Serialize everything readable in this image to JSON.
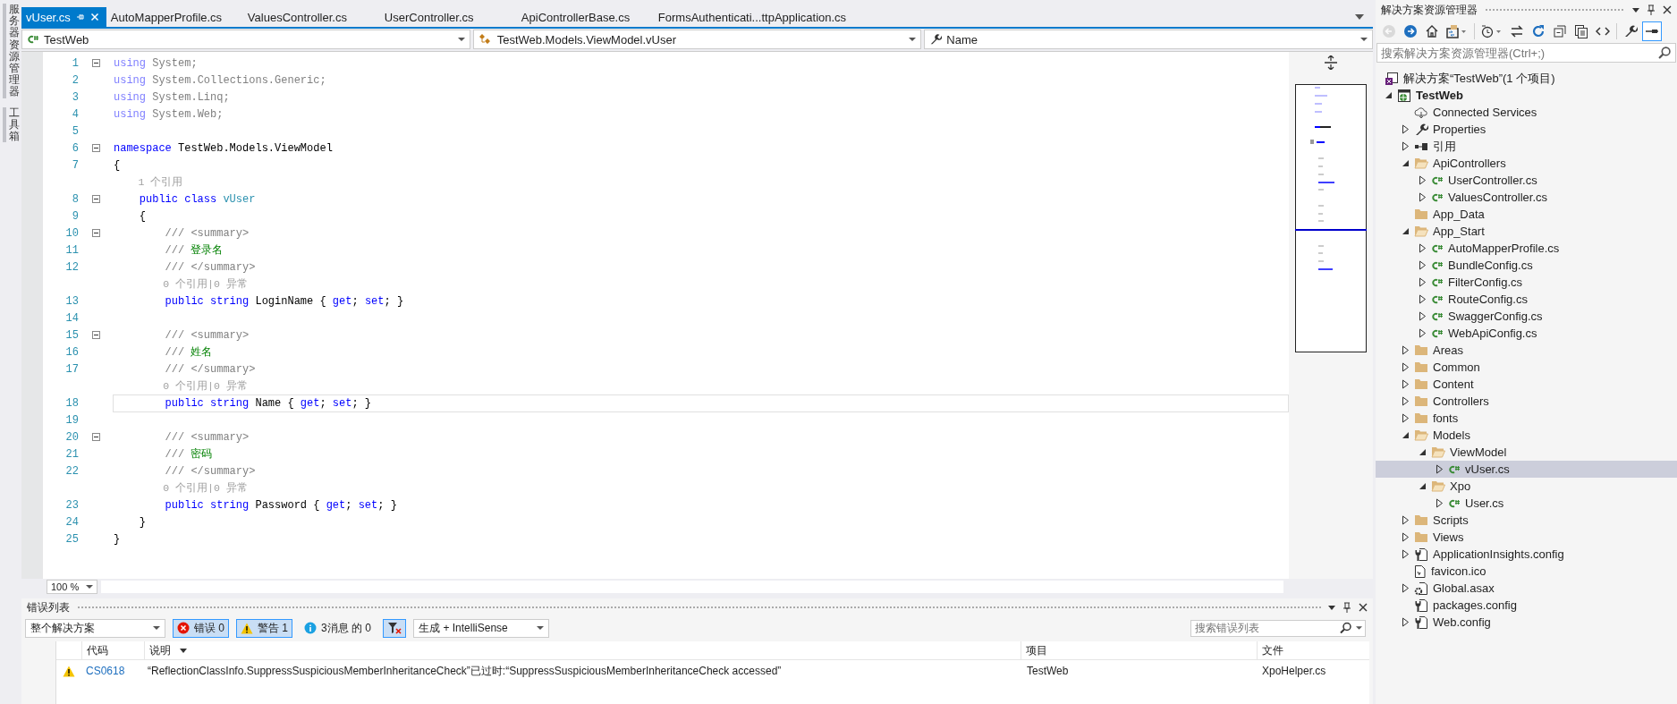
{
  "side_strip": {
    "tabs": [
      {
        "label": "服务器资源管理器"
      },
      {
        "label": "工具箱"
      }
    ]
  },
  "editor": {
    "tabs": [
      {
        "label": "vUser.cs",
        "selected": true
      },
      {
        "label": "AutoMapperProfile.cs",
        "selected": false
      },
      {
        "label": "ValuesController.cs",
        "selected": false
      },
      {
        "label": "UserController.cs",
        "selected": false
      },
      {
        "label": "ApiControllerBase.cs",
        "selected": false
      },
      {
        "label": "FormsAuthenticati...ttpApplication.cs",
        "selected": false
      }
    ],
    "nav": {
      "project": "TestWeb",
      "type": "TestWeb.Models.ViewModel.vUser",
      "member": "Name"
    },
    "lines": [
      {
        "kind": "code",
        "number": "1",
        "foldable": true,
        "current": false,
        "segments": [
          {
            "kind": "faded-keyword",
            "text": "using"
          },
          {
            "kind": "faded",
            "text": " System;"
          }
        ]
      },
      {
        "kind": "code",
        "number": "2",
        "foldable": false,
        "current": false,
        "segments": [
          {
            "kind": "faded-keyword",
            "text": "using"
          },
          {
            "kind": "faded",
            "text": " System.Collections.Generic;"
          }
        ]
      },
      {
        "kind": "code",
        "number": "3",
        "foldable": false,
        "current": false,
        "segments": [
          {
            "kind": "faded-keyword",
            "text": "using"
          },
          {
            "kind": "faded",
            "text": " System.Linq;"
          }
        ]
      },
      {
        "kind": "code",
        "number": "4",
        "foldable": false,
        "current": false,
        "segments": [
          {
            "kind": "faded-keyword",
            "text": "using"
          },
          {
            "kind": "faded",
            "text": " System.Web;"
          }
        ]
      },
      {
        "kind": "code",
        "number": "5",
        "foldable": false,
        "current": false
      },
      {
        "kind": "code",
        "number": "6",
        "foldable": true,
        "current": false,
        "segments": [
          {
            "kind": "keyword",
            "text": "namespace"
          },
          {
            "kind": "plain",
            "text": " TestWeb.Models.ViewModel"
          }
        ]
      },
      {
        "kind": "code",
        "number": "7",
        "foldable": false,
        "current": false,
        "segments": [
          {
            "kind": "plain",
            "text": "{"
          }
        ]
      },
      {
        "kind": "codelens",
        "text": "    1 个引用"
      },
      {
        "kind": "code",
        "number": "8",
        "foldable": true,
        "current": false,
        "segments": [
          {
            "kind": "keyword",
            "text": "    public class "
          },
          {
            "kind": "type",
            "text": "vUser"
          }
        ]
      },
      {
        "kind": "code",
        "number": "9",
        "foldable": false,
        "current": false,
        "segments": [
          {
            "kind": "plain",
            "text": "    {"
          }
        ]
      },
      {
        "kind": "code",
        "number": "10",
        "foldable": true,
        "current": false,
        "segments": [
          {
            "kind": "doc",
            "text": "        /// <summary>"
          }
        ]
      },
      {
        "kind": "code",
        "number": "11",
        "foldable": false,
        "current": false,
        "segments": [
          {
            "kind": "doc",
            "text": "        /// "
          },
          {
            "kind": "comment",
            "text": "登录名"
          }
        ]
      },
      {
        "kind": "code",
        "number": "12",
        "foldable": false,
        "current": false,
        "segments": [
          {
            "kind": "doc",
            "text": "        /// </summary>"
          }
        ]
      },
      {
        "kind": "codelens",
        "text": "        0 个引用|0 异常"
      },
      {
        "kind": "code",
        "number": "13",
        "foldable": false,
        "current": false,
        "segments": [
          {
            "kind": "keyword",
            "text": "        public string"
          },
          {
            "kind": "plain",
            "text": " LoginName { "
          },
          {
            "kind": "keyword",
            "text": "get"
          },
          {
            "kind": "plain",
            "text": "; "
          },
          {
            "kind": "keyword",
            "text": "set"
          },
          {
            "kind": "plain",
            "text": "; }"
          }
        ]
      },
      {
        "kind": "code",
        "number": "14",
        "foldable": false,
        "current": false
      },
      {
        "kind": "code",
        "number": "15",
        "foldable": true,
        "current": false,
        "segments": [
          {
            "kind": "doc",
            "text": "        /// <summary>"
          }
        ]
      },
      {
        "kind": "code",
        "number": "16",
        "foldable": false,
        "current": false,
        "segments": [
          {
            "kind": "doc",
            "text": "        /// "
          },
          {
            "kind": "comment",
            "text": "姓名"
          }
        ]
      },
      {
        "kind": "code",
        "number": "17",
        "foldable": false,
        "current": false,
        "segments": [
          {
            "kind": "doc",
            "text": "        /// </summary>"
          }
        ]
      },
      {
        "kind": "codelens",
        "text": "        0 个引用|0 异常"
      },
      {
        "kind": "code",
        "number": "18",
        "foldable": false,
        "current": true,
        "segments": [
          {
            "kind": "keyword",
            "text": "        public string"
          },
          {
            "kind": "plain",
            "text": " Name { "
          },
          {
            "kind": "keyword",
            "text": "get"
          },
          {
            "kind": "plain",
            "text": "; "
          },
          {
            "kind": "keyword",
            "text": "set"
          },
          {
            "kind": "plain",
            "text": "; }"
          }
        ]
      },
      {
        "kind": "code",
        "number": "19",
        "foldable": false,
        "current": false
      },
      {
        "kind": "code",
        "number": "20",
        "foldable": true,
        "current": false,
        "segments": [
          {
            "kind": "doc",
            "text": "        /// <summary>"
          }
        ]
      },
      {
        "kind": "code",
        "number": "21",
        "foldable": false,
        "current": false,
        "segments": [
          {
            "kind": "doc",
            "text": "        /// "
          },
          {
            "kind": "comment",
            "text": "密码"
          }
        ]
      },
      {
        "kind": "code",
        "number": "22",
        "foldable": false,
        "current": false,
        "segments": [
          {
            "kind": "doc",
            "text": "        /// </summary>"
          }
        ]
      },
      {
        "kind": "codelens",
        "text": "        0 个引用|0 异常"
      },
      {
        "kind": "code",
        "number": "23",
        "foldable": false,
        "current": false,
        "segments": [
          {
            "kind": "keyword",
            "text": "        public string"
          },
          {
            "kind": "plain",
            "text": " Password { "
          },
          {
            "kind": "keyword",
            "text": "get"
          },
          {
            "kind": "plain",
            "text": "; "
          },
          {
            "kind": "keyword",
            "text": "set"
          },
          {
            "kind": "plain",
            "text": "; }"
          }
        ]
      },
      {
        "kind": "code",
        "number": "24",
        "foldable": false,
        "current": false,
        "segments": [
          {
            "kind": "plain",
            "text": "    }"
          }
        ]
      },
      {
        "kind": "code",
        "number": "25",
        "foldable": false,
        "current": false,
        "segments": [
          {
            "kind": "plain",
            "text": "}"
          }
        ]
      }
    ],
    "zoom": "100 %"
  },
  "error_list": {
    "title": "错误列表",
    "scope": "整个解决方案",
    "filters": [
      {
        "kind": "error",
        "label": "错误 0",
        "on": true
      },
      {
        "kind": "warning",
        "label": "警告 1",
        "on": true
      },
      {
        "kind": "info",
        "label": "3消息 的 0",
        "on": false
      }
    ],
    "build_filter": {
      "pressed": true
    },
    "source": "生成 + IntelliSense",
    "search": {
      "placeholder": "搜索错误列表"
    },
    "columns": [
      "代码",
      "说明",
      "项目",
      "文件"
    ],
    "rows": [
      {
        "kind": "warning",
        "code": "CS0618",
        "description": "“ReflectionClassInfo.SuppressSuspiciousMemberInheritanceCheck”已过时:“SuppressSuspiciousMemberInheritanceCheck accessed”",
        "project": "TestWeb",
        "file": "XpoHelper.cs"
      }
    ]
  },
  "solution_explorer": {
    "title": "解决方案资源管理器",
    "toolbar": [
      {
        "kind": "back",
        "disabled": true,
        "pressed": false
      },
      {
        "kind": "forward",
        "disabled": false,
        "pressed": false
      },
      {
        "kind": "home",
        "disabled": false,
        "pressed": false
      },
      {
        "kind": "sync",
        "disabled": false,
        "pressed": false
      },
      {
        "kind": "history",
        "disabled": false,
        "pressed": false
      },
      {
        "kind": "pending",
        "disabled": false,
        "pressed": false
      },
      {
        "kind": "refresh",
        "disabled": false,
        "pressed": false
      },
      {
        "kind": "collapse",
        "disabled": false,
        "pressed": false
      },
      {
        "kind": "show-all",
        "disabled": false,
        "pressed": false
      },
      {
        "kind": "code",
        "disabled": false,
        "pressed": false
      },
      {
        "kind": "properties",
        "disabled": false,
        "pressed": false
      },
      {
        "kind": "preview",
        "disabled": false,
        "pressed": true
      }
    ],
    "search": {
      "placeholder": "搜索解决方案资源管理器(Ctrl+;)"
    },
    "solution": {
      "label": "解决方案“TestWeb”(1 个项目)",
      "selected": false
    },
    "items": [
      {
        "label": "TestWeb",
        "kind": "project",
        "expanded": true,
        "selected": false,
        "children": [
          {
            "label": "Connected Services",
            "kind": "service",
            "selected": false
          },
          {
            "label": "Properties",
            "kind": "properties",
            "expanded": false,
            "selected": false
          },
          {
            "label": "引用",
            "kind": "references",
            "expanded": false,
            "selected": false
          },
          {
            "label": "ApiControllers",
            "kind": "folder",
            "expanded": true,
            "selected": false,
            "children": [
              {
                "label": "UserController.cs",
                "kind": "csharp",
                "expanded": false,
                "selected": false
              },
              {
                "label": "ValuesController.cs",
                "kind": "csharp",
                "expanded": false,
                "selected": false
              }
            ]
          },
          {
            "label": "App_Data",
            "kind": "folder",
            "selected": false
          },
          {
            "label": "App_Start",
            "kind": "folder",
            "expanded": true,
            "selected": false,
            "children": [
              {
                "label": "AutoMapperProfile.cs",
                "kind": "csharp",
                "expanded": false,
                "selected": false
              },
              {
                "label": "BundleConfig.cs",
                "kind": "csharp",
                "expanded": false,
                "selected": false
              },
              {
                "label": "FilterConfig.cs",
                "kind": "csharp",
                "expanded": false,
                "selected": false
              },
              {
                "label": "RouteConfig.cs",
                "kind": "csharp",
                "expanded": false,
                "selected": false
              },
              {
                "label": "SwaggerConfig.cs",
                "kind": "csharp",
                "expanded": false,
                "selected": false
              },
              {
                "label": "WebApiConfig.cs",
                "kind": "csharp",
                "expanded": false,
                "selected": false
              }
            ]
          },
          {
            "label": "Areas",
            "kind": "folder",
            "expanded": false,
            "selected": false
          },
          {
            "label": "Common",
            "kind": "folder",
            "expanded": false,
            "selected": false
          },
          {
            "label": "Content",
            "kind": "folder",
            "expanded": false,
            "selected": false
          },
          {
            "label": "Controllers",
            "kind": "folder",
            "expanded": false,
            "selected": false
          },
          {
            "label": "fonts",
            "kind": "folder",
            "expanded": false,
            "selected": false
          },
          {
            "label": "Models",
            "kind": "folder",
            "expanded": true,
            "selected": false,
            "children": [
              {
                "label": "ViewModel",
                "kind": "folder",
                "expanded": true,
                "selected": false,
                "children": [
                  {
                    "label": "vUser.cs",
                    "kind": "csharp",
                    "expanded": false,
                    "selected": true
                  }
                ]
              },
              {
                "label": "Xpo",
                "kind": "folder",
                "expanded": true,
                "selected": false,
                "children": [
                  {
                    "label": "User.cs",
                    "kind": "csharp",
                    "expanded": false,
                    "selected": false
                  }
                ]
              }
            ]
          },
          {
            "label": "Scripts",
            "kind": "folder",
            "expanded": false,
            "selected": false
          },
          {
            "label": "Views",
            "kind": "folder",
            "expanded": false,
            "selected": false
          },
          {
            "label": "ApplicationInsights.config",
            "kind": "config",
            "expanded": false,
            "selected": false
          },
          {
            "label": "favicon.ico",
            "kind": "image",
            "selected": false
          },
          {
            "label": "Global.asax",
            "kind": "asax",
            "expanded": false,
            "selected": false
          },
          {
            "label": "packages.config",
            "kind": "config",
            "selected": false
          },
          {
            "label": "Web.config",
            "kind": "config",
            "expanded": false,
            "selected": false
          }
        ]
      }
    ]
  }
}
